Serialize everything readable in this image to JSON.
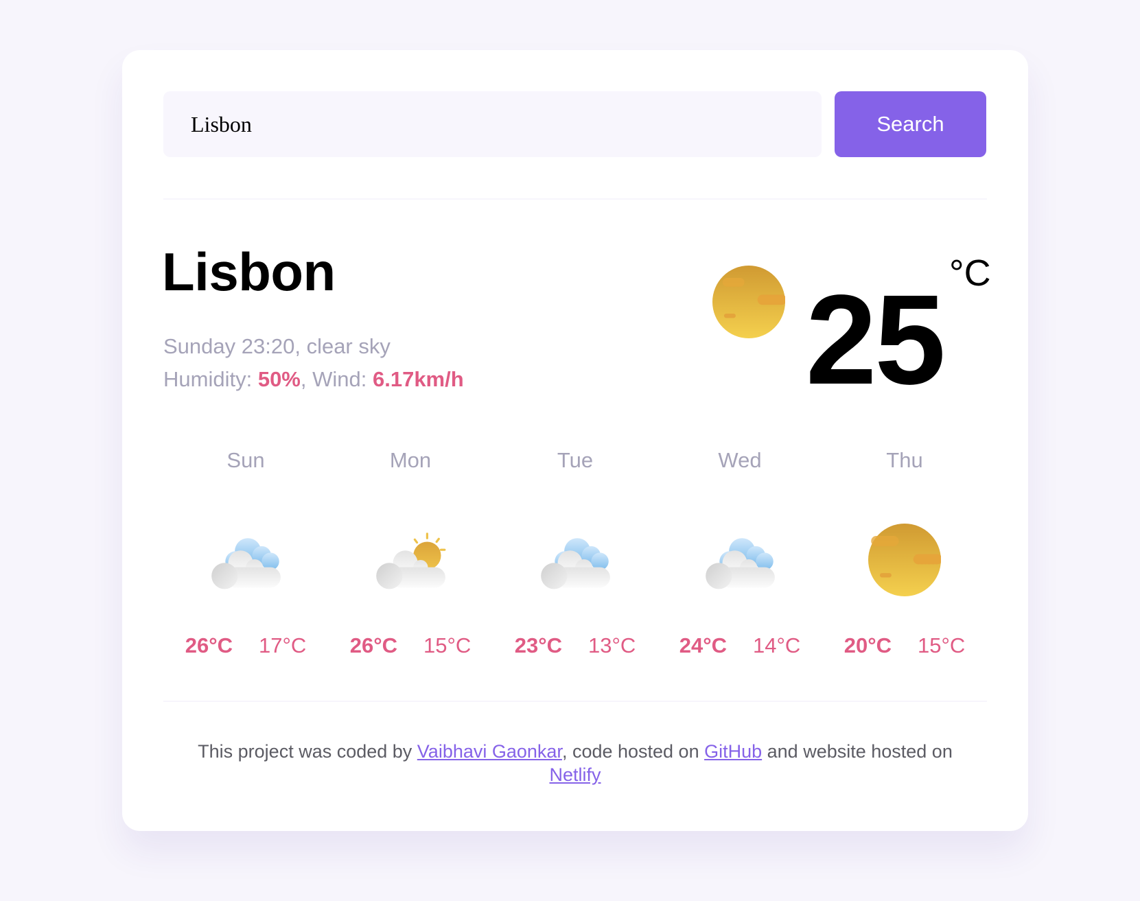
{
  "search": {
    "value": "Lisbon",
    "button_label": "Search"
  },
  "current": {
    "city": "Lisbon",
    "day_time": "Sunday 23:20",
    "description": "clear sky",
    "humidity_label": "Humidity:",
    "humidity_value": "50%",
    "wind_label": "Wind:",
    "wind_value": "6.17km/h",
    "temperature": "25",
    "unit": "°C",
    "icon": "clear-sky-sun-icon"
  },
  "forecast": [
    {
      "day": "Sun",
      "icon": "broken-clouds-icon",
      "max": "26°C",
      "min": "17°C"
    },
    {
      "day": "Mon",
      "icon": "few-clouds-sun-icon",
      "max": "26°C",
      "min": "15°C"
    },
    {
      "day": "Tue",
      "icon": "broken-clouds-icon",
      "max": "23°C",
      "min": "13°C"
    },
    {
      "day": "Wed",
      "icon": "broken-clouds-icon",
      "max": "24°C",
      "min": "14°C"
    },
    {
      "day": "Thu",
      "icon": "clear-sky-sun-icon",
      "max": "20°C",
      "min": "15°C"
    }
  ],
  "footer": {
    "text_1": "This project was coded by ",
    "author_link": "Vaibhavi Gaonkar",
    "text_2": ", code hosted on ",
    "github_link": "GitHub",
    "text_3": " and website hosted on ",
    "netlify_link": "Netlify"
  },
  "colors": {
    "accent": "#8562e8",
    "highlight": "#e05b84",
    "muted": "#a5a3b8",
    "background": "#f7f5fc"
  }
}
